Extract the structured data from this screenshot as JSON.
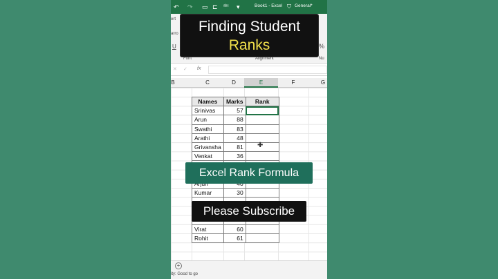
{
  "titlebar": {
    "title": "Book1 - Excel",
    "sensitivity": "General*"
  },
  "ribbon": {
    "tab_partial": "ert",
    "row2_partial": "arro",
    "underline": "U",
    "percent": "%",
    "font_group": "Font",
    "alignment_group": "Alignment",
    "number_group_partial": "Nu"
  },
  "formula_bar": {
    "fx": "fx",
    "cancel": "✕",
    "accept": "✓",
    "value": ""
  },
  "columns": [
    "B",
    "C",
    "D",
    "E",
    "F",
    "G"
  ],
  "selected_column": "E",
  "table": {
    "headers": [
      "Names",
      "Marks",
      "Rank"
    ],
    "rows": [
      {
        "name": "Srinivas",
        "marks": "57"
      },
      {
        "name": "Arun",
        "marks": "88"
      },
      {
        "name": "Swathi",
        "marks": "83"
      },
      {
        "name": "Arathi",
        "marks": "48"
      },
      {
        "name": "Grivansha",
        "marks": "81"
      },
      {
        "name": "Venkat",
        "marks": "36"
      },
      {
        "name": "",
        "marks": ""
      },
      {
        "name": "",
        "marks": ""
      },
      {
        "name": "Arjun",
        "marks": "40"
      },
      {
        "name": "Kumar",
        "marks": "30"
      },
      {
        "name": "",
        "marks": ""
      },
      {
        "name": "",
        "marks": ""
      },
      {
        "name": "",
        "marks": ""
      },
      {
        "name": "Virat",
        "marks": "60"
      },
      {
        "name": "Rohit",
        "marks": "61"
      }
    ]
  },
  "overlays": {
    "title_line1": "Finding Student",
    "title_line2": "Ranks",
    "banner_formula": "Excel Rank Formula",
    "banner_subscribe": "Please Subscribe"
  },
  "statusbar": {
    "text": "ity: Good to go",
    "add_sheet": "+"
  },
  "colors": {
    "excel_green": "#217346",
    "background": "#3f8a6e",
    "title_accent": "#f2e14b",
    "banner_teal": "#1f6f5b"
  }
}
